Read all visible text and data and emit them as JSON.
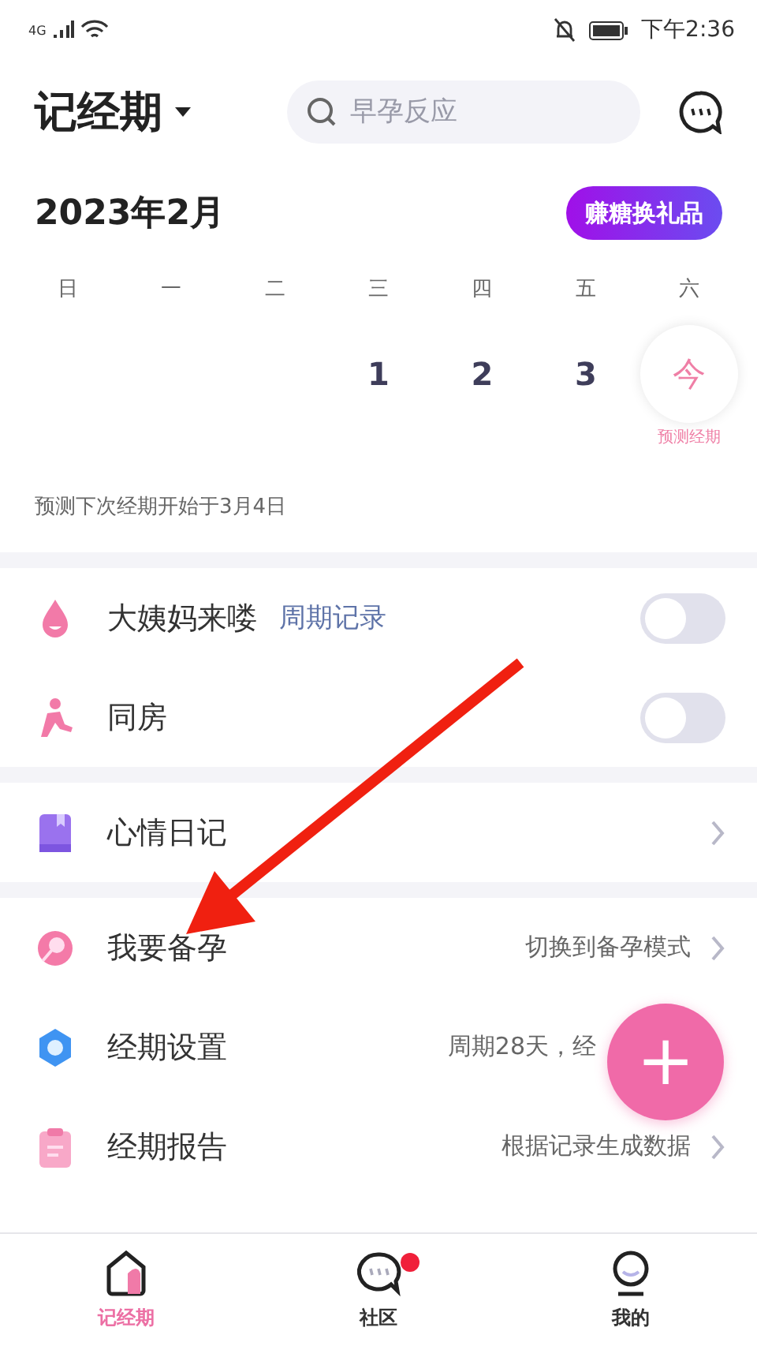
{
  "status_bar": {
    "network": "4G",
    "time": "下午2:36"
  },
  "header": {
    "title": "记经期",
    "search": {
      "placeholder": "早孕反应"
    }
  },
  "calendar": {
    "month": "2023年2月",
    "reward_button": "赚糖换礼品",
    "weekdays": [
      "日",
      "一",
      "二",
      "三",
      "四",
      "五",
      "六"
    ],
    "days": [
      {
        "kind": "empty"
      },
      {
        "kind": "empty"
      },
      {
        "kind": "empty"
      },
      {
        "kind": "day",
        "label": "1"
      },
      {
        "kind": "day",
        "label": "2"
      },
      {
        "kind": "day",
        "label": "3"
      },
      {
        "kind": "today",
        "label": "今",
        "note": "预测经期"
      }
    ],
    "prediction": "预测下次经期开始于3月4日"
  },
  "sections": [
    {
      "items": [
        {
          "kind": "toggle",
          "label": "大姨妈来喽",
          "link": "周期记录",
          "on": false
        },
        {
          "kind": "toggle",
          "label": "同房",
          "on": false
        }
      ]
    },
    {
      "items": [
        {
          "kind": "nav",
          "label": "心情日记"
        }
      ]
    },
    {
      "items": [
        {
          "kind": "nav",
          "label": "我要备孕",
          "value": "切换到备孕模式"
        },
        {
          "kind": "nav",
          "label": "经期设置",
          "value": "周期28天，经"
        },
        {
          "kind": "nav",
          "label": "经期报告",
          "value": "根据记录生成数据"
        }
      ]
    }
  ],
  "fab": "+",
  "tabs": [
    {
      "label": "记经期",
      "selected": true,
      "badge": false
    },
    {
      "label": "社区",
      "selected": false,
      "badge": true
    },
    {
      "label": "我的",
      "selected": false,
      "badge": false
    }
  ]
}
